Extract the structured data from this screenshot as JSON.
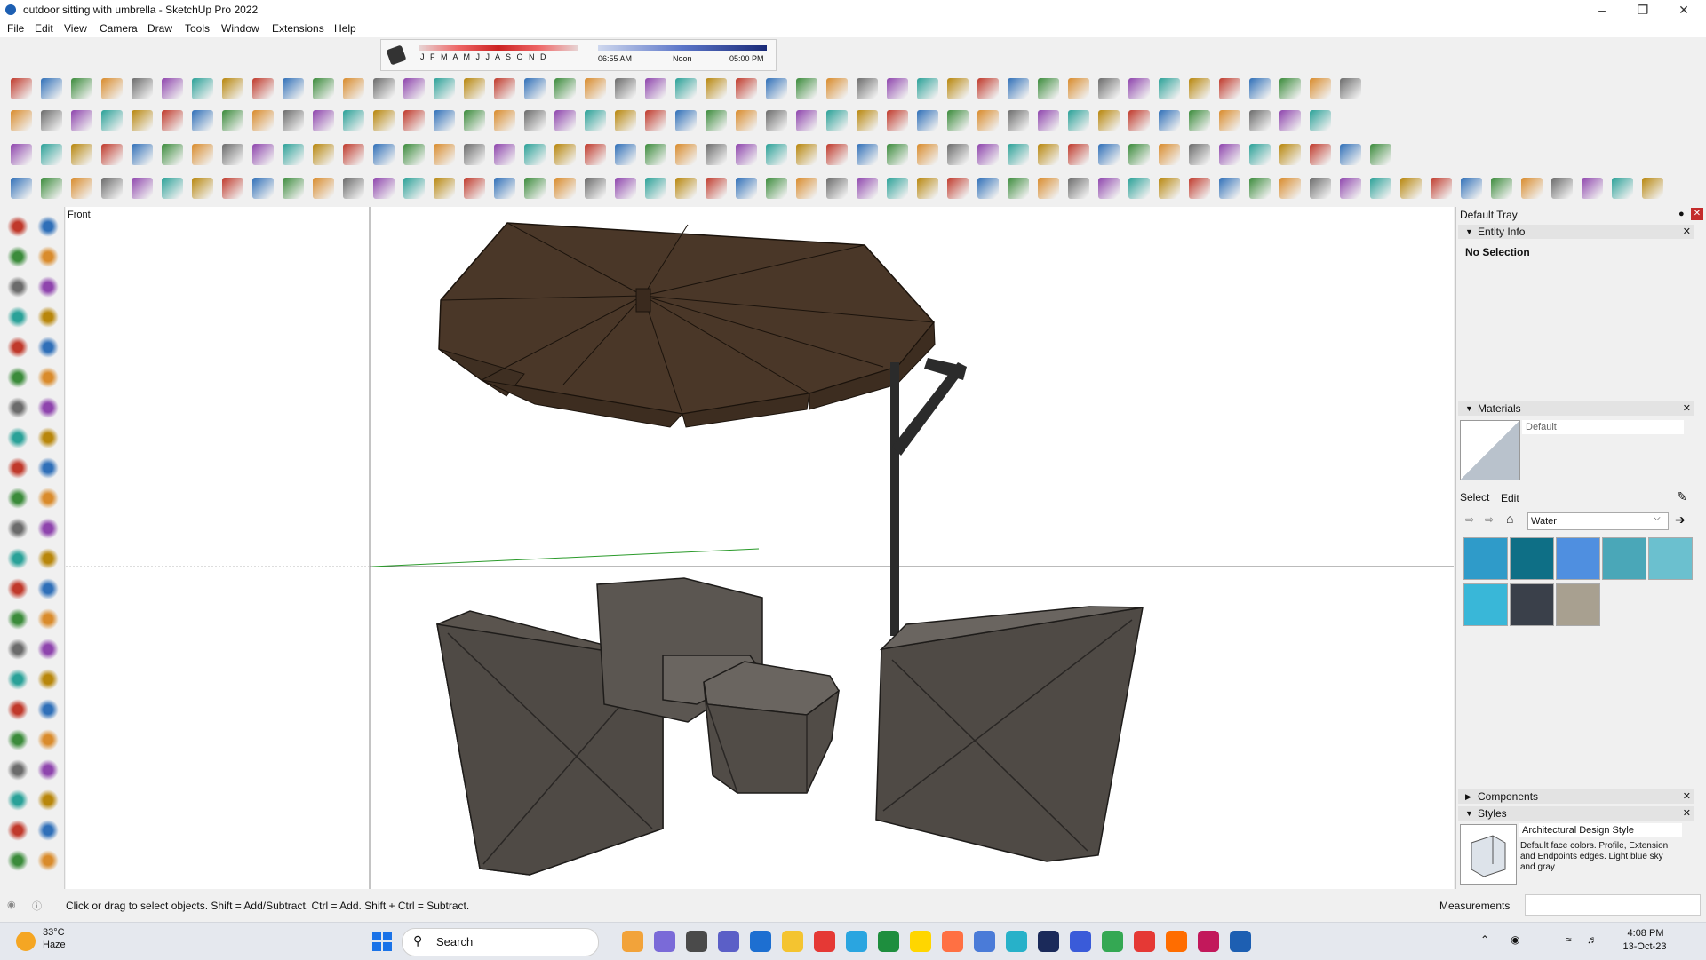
{
  "window": {
    "title": "outdoor sitting with umbrella - SketchUp Pro 2022"
  },
  "menu": [
    "File",
    "Edit",
    "View",
    "Camera",
    "Draw",
    "Tools",
    "Window",
    "Extensions",
    "Help"
  ],
  "shadow": {
    "months": "J F M A M J J A S O N D",
    "time_start": "06:55 AM",
    "time_noon": "Noon",
    "time_end": "05:00 PM"
  },
  "viewport": {
    "scene_label": "Front"
  },
  "tray": {
    "title": "Default Tray",
    "entity_info": {
      "header": "Entity Info",
      "text": "No Selection"
    },
    "materials": {
      "header": "Materials",
      "current_name": "Default",
      "tab_select": "Select",
      "tab_edit": "Edit",
      "library": "Water",
      "swatch_colors": [
        "#2f9bc9",
        "#0e6f86",
        "#4f8fe0",
        "#4aa7b8",
        "#6bc0cf",
        "#39b7d8",
        "#3a404a",
        "#a8a090"
      ]
    },
    "components": {
      "header": "Components"
    },
    "styles": {
      "header": "Styles",
      "style_name": "Architectural Design Style",
      "description": "Default face colors. Profile, Extension and Endpoints edges. Light blue sky and gray"
    }
  },
  "status": {
    "hint": "Click or drag to select objects. Shift = Add/Subtract. Ctrl = Add. Shift + Ctrl = Subtract.",
    "measurements_label": "Measurements"
  },
  "taskbar": {
    "weather_temp": "33°C",
    "weather_desc": "Haze",
    "search_placeholder": "Search",
    "time": "4:08 PM",
    "date": "13-Oct-23"
  },
  "colors": {
    "umbrella": "#4a3728",
    "wicker": "#55504b",
    "pole": "#2b2b2b",
    "accent": "#1d5fb2"
  }
}
